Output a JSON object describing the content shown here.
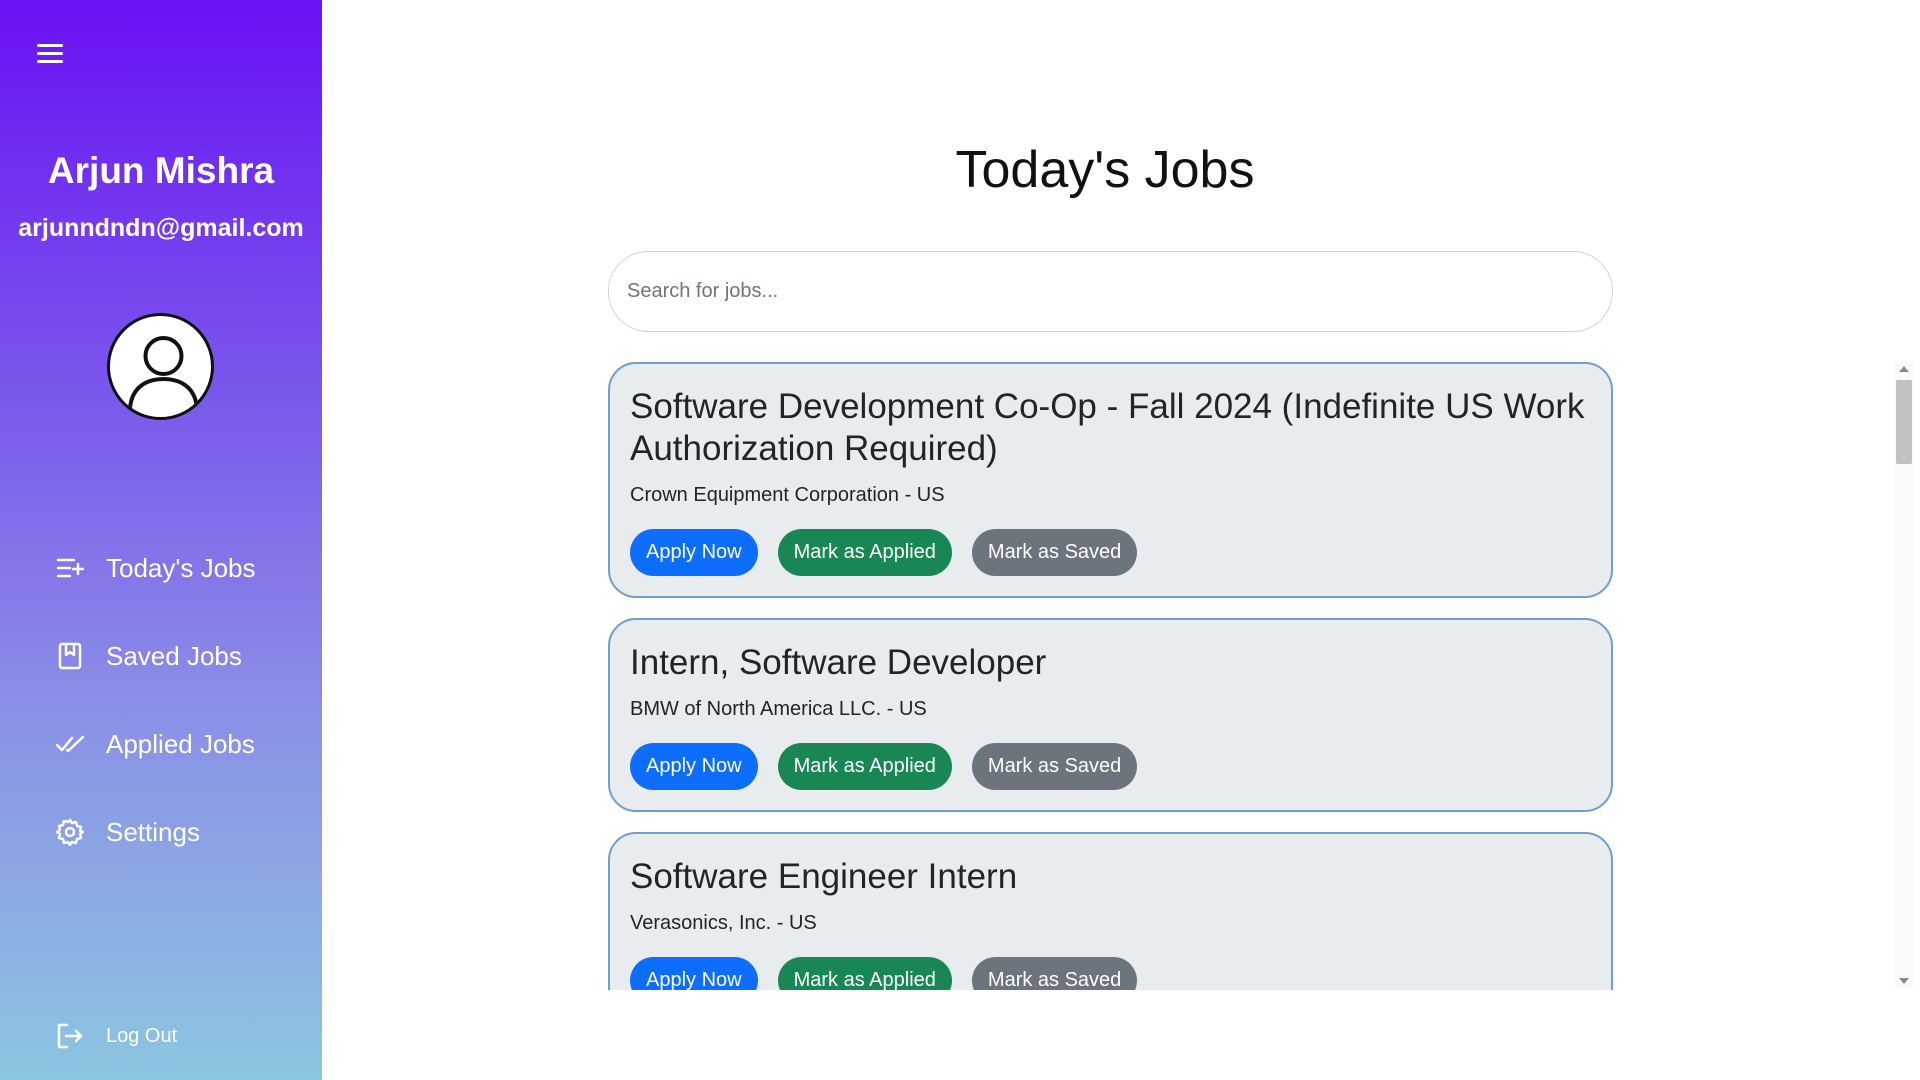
{
  "sidebar": {
    "user_name": "Arjun Mishra",
    "user_email": "arjunndndn@gmail.com",
    "nav": [
      {
        "label": "Today's Jobs",
        "icon": "list-add-icon"
      },
      {
        "label": "Saved Jobs",
        "icon": "bookmark-icon"
      },
      {
        "label": "Applied Jobs",
        "icon": "double-check-icon"
      },
      {
        "label": "Settings",
        "icon": "gear-icon"
      }
    ],
    "logout_label": "Log Out"
  },
  "main": {
    "title": "Today's Jobs",
    "search_placeholder": "Search for jobs...",
    "jobs": [
      {
        "title": "Software Development Co-Op - Fall 2024 (Indefinite US Work Authorization Required)",
        "company": "Crown Equipment Corporation - US"
      },
      {
        "title": "Intern, Software Developer",
        "company": "BMW of North America LLC. - US"
      },
      {
        "title": "Software Engineer Intern",
        "company": "Verasonics, Inc. - US"
      }
    ],
    "buttons": {
      "apply": "Apply Now",
      "mark_applied": "Mark as Applied",
      "mark_saved": "Mark as Saved"
    }
  },
  "colors": {
    "sidebar_gradient_top": "#6a11f4",
    "sidebar_gradient_bottom": "#8cc6e0",
    "apply": "#0d6efd",
    "applied": "#198754",
    "saved": "#6c757d",
    "card_bg": "#e9ecef",
    "card_border": "#6f9fcc"
  }
}
